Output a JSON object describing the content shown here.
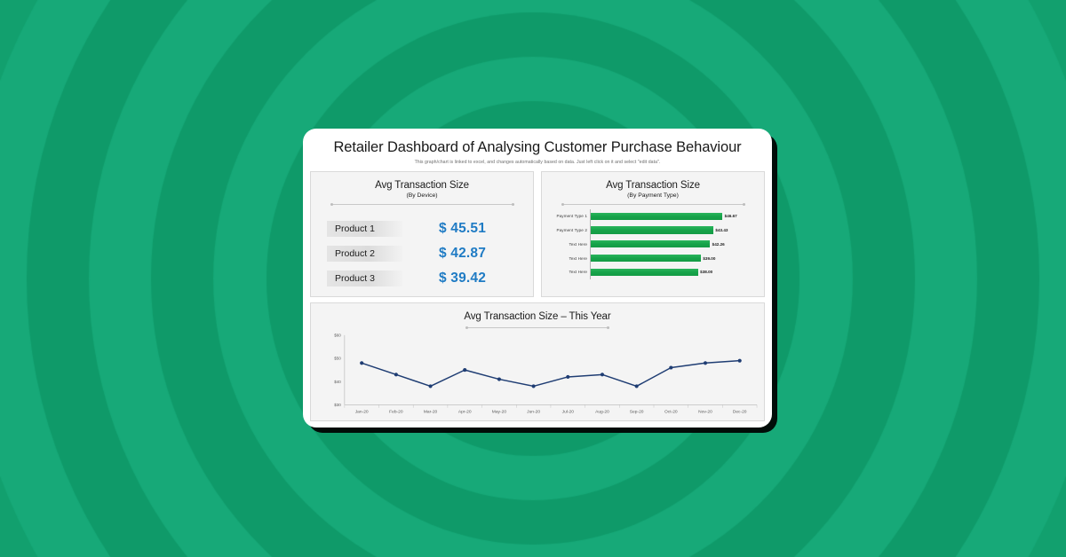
{
  "background": {
    "base_color": "#12a06e",
    "ring_color_light": "#17a978",
    "ring_color_dark": "#0f9a69"
  },
  "card": {
    "title": "Retailer Dashboard of Analysing Customer Purchase Behaviour",
    "subtitle": "This graph/chart is linked to excel, and changes automatically based on data. Just left click on it and select \"edit data\"."
  },
  "panel_device": {
    "title": "Avg Transaction Size",
    "subtitle": "(By Device)",
    "value_color": "#1f7bc4",
    "rows": [
      {
        "label": "Product 1",
        "value": "$ 45.51"
      },
      {
        "label": "Product 2",
        "value": "$ 42.87"
      },
      {
        "label": "Product 3",
        "value": "$ 39.42"
      }
    ]
  },
  "panel_payment": {
    "title": "Avg Transaction Size",
    "subtitle": "(By Payment Type)",
    "bar_color": "#16a34a"
  },
  "panel_year": {
    "title": "Avg Transaction Size – This Year",
    "line_color": "#1f3d73"
  },
  "chart_data": [
    {
      "type": "bar",
      "orientation": "horizontal",
      "title": "Avg Transaction Size",
      "subtitle": "(By Payment Type)",
      "categories": [
        "Payment Type 1",
        "Payment Type 2",
        "Text Here",
        "Text Here",
        "Text Here"
      ],
      "values": [
        46.67,
        43.43,
        42.26,
        39.0,
        38.0
      ],
      "labels": [
        "$46.67",
        "$43.43",
        "$42.26",
        "$39.00",
        "$38.00"
      ],
      "xlabel": "",
      "ylabel": "",
      "xlim": [
        0,
        50
      ],
      "grid": false,
      "legend": "none",
      "series_color": "#16a34a"
    },
    {
      "type": "line",
      "title": "Avg Transaction Size – This Year",
      "categories": [
        "Jan-20",
        "Feb-20",
        "Mar-20",
        "Apr-20",
        "May-20",
        "Jun-20",
        "Jul-20",
        "Aug-20",
        "Sep-20",
        "Oct-20",
        "Nov-20",
        "Dec-20"
      ],
      "values": [
        48,
        43,
        38,
        45,
        41,
        38,
        42,
        43,
        38,
        46,
        48,
        49
      ],
      "ytick_labels": [
        "$30",
        "$40",
        "$50",
        "$60"
      ],
      "ytick_values": [
        30,
        40,
        50,
        60
      ],
      "ylim": [
        30,
        60
      ],
      "xlabel": "",
      "ylabel": "",
      "grid": false,
      "legend": "none",
      "series_color": "#1f3d73",
      "marker": "circle"
    },
    {
      "type": "table",
      "title": "Avg Transaction Size",
      "subtitle": "(By Device)",
      "categories": [
        "Product 1",
        "Product 2",
        "Product 3"
      ],
      "values": [
        45.51,
        42.87,
        39.42
      ],
      "labels": [
        "$ 45.51",
        "$ 42.87",
        "$ 39.42"
      ]
    }
  ]
}
